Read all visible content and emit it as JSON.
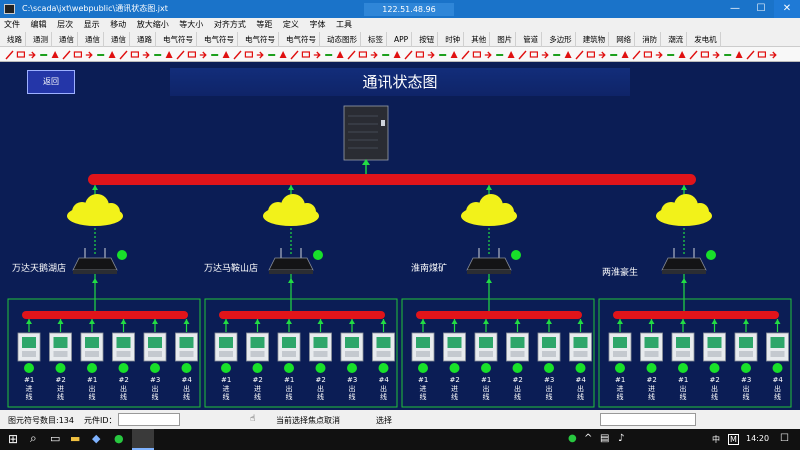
{
  "window": {
    "path": "C:\\scada\\jxt\\webpublic\\通讯状态图.jxt",
    "ip": "122.51.48.96",
    "minimize": "—",
    "maximize": "☐",
    "close": "✕"
  },
  "menu": [
    "文件",
    "编辑",
    "层次",
    "显示",
    "移动",
    "放大缩小",
    "等大小",
    "对齐方式",
    "等距",
    "定义",
    "字体",
    "工具"
  ],
  "tabs": [
    "线路",
    "通测",
    "通信",
    "通信",
    "通信",
    "通路",
    "电气符号",
    "电气符号",
    "电气符号",
    "电气符号",
    "动态图形",
    "标签",
    "APP",
    "按钮",
    "时钟",
    "其他",
    "图片",
    "管道",
    "多边形",
    "建筑物",
    "网络",
    "消防",
    "潮流",
    "发电机"
  ],
  "canvas": {
    "back_button": "返回",
    "title": "通讯状态图",
    "sites": [
      {
        "name": "万达天鹅湖店",
        "feeders": [
          "#1进线",
          "#2进线",
          "#1出线",
          "#2出线",
          "#3出线",
          "#4出线"
        ]
      },
      {
        "name": "万达马鞍山店",
        "feeders": [
          "#1进线",
          "#2进线",
          "#1出线",
          "#2出线",
          "#3出线",
          "#4出线"
        ]
      },
      {
        "name": "淮南煤矿",
        "feeders": [
          "#1进线",
          "#2进线",
          "#1出线",
          "#2出线",
          "#3出线",
          "#4出线"
        ]
      },
      {
        "name": "两淮豪生",
        "feeders": [
          "#1进线",
          "#2进线",
          "#1出线",
          "#2出线",
          "#3出线",
          "#4出线"
        ]
      }
    ],
    "colors": {
      "bus": "#e0141a",
      "link": "#22dd44",
      "status_ok": "#18e02a",
      "cloud": "#f2f21a"
    }
  },
  "statusbar": {
    "count_label": "图元符号数目:134",
    "id_label": "元件ID：",
    "hint": "当前选择焦点取消",
    "select": "选择"
  },
  "taskbar": {
    "time": "14:20",
    "lang": "中",
    "ime": "M"
  }
}
